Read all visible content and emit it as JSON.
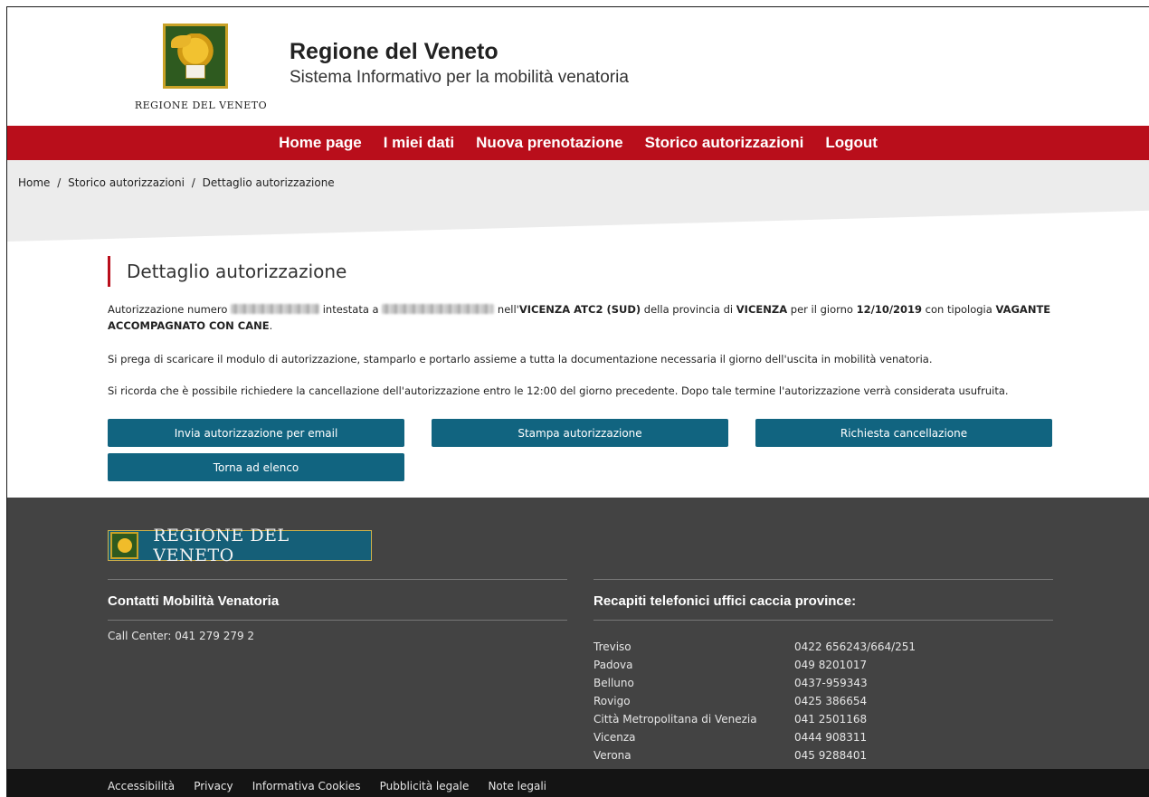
{
  "header": {
    "logo_text": "REGIONE DEL VENETO",
    "title": "Regione del Veneto",
    "subtitle": "Sistema Informativo per la mobilità venatoria"
  },
  "nav": {
    "items": [
      "Home page",
      "I miei dati",
      "Nuova prenotazione",
      "Storico autorizzazioni",
      "Logout"
    ]
  },
  "breadcrumb": {
    "items": [
      "Home",
      "Storico autorizzazioni",
      "Dettaglio autorizzazione"
    ],
    "separator": "/"
  },
  "main": {
    "title": "Dettaglio autorizzazione",
    "p1": {
      "t1": "Autorizzazione numero ",
      "t2": " intestata a ",
      "t3": " nell'",
      "atc": "VICENZA ATC2 (SUD)",
      "t4": " della provincia di ",
      "province": "VICENZA",
      "t5": " per il giorno ",
      "date": "12/10/2019",
      "t6": " con tipologia ",
      "type": "VAGANTE ACCOMPAGNATO CON CANE",
      "t7": "."
    },
    "p2": "Si prega di scaricare il modulo di autorizzazione, stamparlo e portarlo assieme a tutta la documentazione necessaria il giorno dell'uscita in mobilità venatoria.",
    "p3": "Si ricorda che è possibile richiedere la cancellazione dell'autorizzazione entro le 12:00 del giorno precedente. Dopo tale termine l'autorizzazione verrà considerata usufruita.",
    "buttons": {
      "email": "Invia autorizzazione per email",
      "print": "Stampa autorizzazione",
      "cancel": "Richiesta cancellazione",
      "back": "Torna ad elenco"
    }
  },
  "footer": {
    "logo_text": "REGIONE DEL VENETO",
    "contacts_title": "Contatti Mobilità Venatoria",
    "call_center": "Call Center: 041 279 279 2",
    "phones_title": "Recapiti telefonici uffici caccia province:",
    "phones": [
      {
        "city": "Treviso",
        "number": "0422 656243/664/251"
      },
      {
        "city": "Padova",
        "number": "049 8201017"
      },
      {
        "city": "Belluno",
        "number": "0437-959343"
      },
      {
        "city": "Rovigo",
        "number": "0425 386654"
      },
      {
        "city": "Città Metropolitana di Venezia",
        "number": "041 2501168"
      },
      {
        "city": "Vicenza",
        "number": "0444 908311"
      },
      {
        "city": "Verona",
        "number": "045 9288401"
      }
    ]
  },
  "bottom_links": [
    "Accessibilità",
    "Privacy",
    "Informativa Cookies",
    "Pubblicità legale",
    "Note legali"
  ],
  "colors": {
    "brand_red": "#b90e1b",
    "button_teal": "#116480",
    "footer_gray": "#434343",
    "bottom_black": "#141414"
  }
}
